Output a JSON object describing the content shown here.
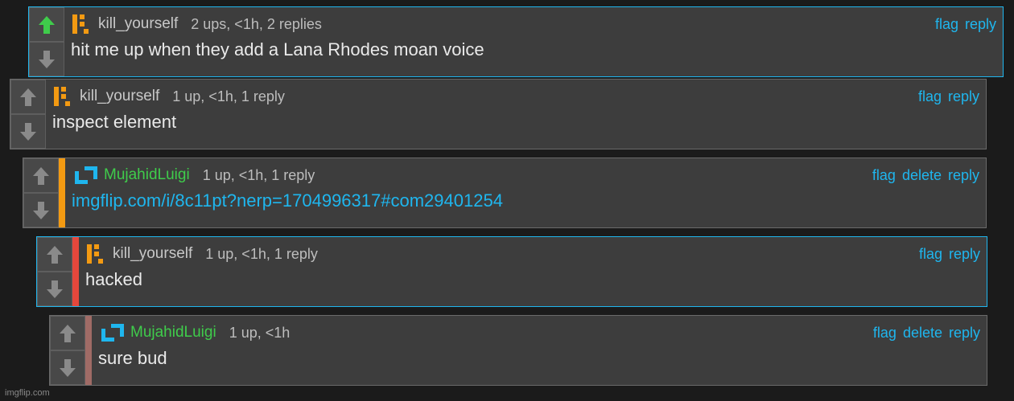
{
  "comments": [
    {
      "user": "kill_yourself",
      "meta": "2 ups, <1h, 2 replies",
      "flag": "flag",
      "delete": null,
      "reply": "reply",
      "text": "hit me up when they add a Lana Rhodes moan voice",
      "upvoted": true,
      "avatar": "k-logo",
      "stripe": null,
      "highlighted": true,
      "link": false
    },
    {
      "user": "kill_yourself",
      "meta": "1 up, <1h, 1 reply",
      "flag": "flag",
      "delete": null,
      "reply": "reply",
      "text": "inspect element",
      "upvoted": false,
      "avatar": "k-logo",
      "stripe": null,
      "highlighted": false,
      "link": false
    },
    {
      "user": "MujahidLuigi",
      "meta": "1 up, <1h, 1 reply",
      "flag": "flag",
      "delete": "delete",
      "reply": "reply",
      "text": "imgflip.com/i/8c11pt?nerp=1704996317#com29401254",
      "upvoted": false,
      "avatar": "bracket-logo",
      "stripe": "#f39a12",
      "highlighted": false,
      "link": true
    },
    {
      "user": "kill_yourself",
      "meta": "1 up, <1h, 1 reply",
      "flag": "flag",
      "delete": null,
      "reply": "reply",
      "text": "hacked",
      "upvoted": false,
      "avatar": "k-logo",
      "stripe": "#e4473c",
      "highlighted": true,
      "link": false
    },
    {
      "user": "MujahidLuigi",
      "meta": "1 up, <1h",
      "flag": "flag",
      "delete": "delete",
      "reply": "reply",
      "text": "sure bud",
      "upvoted": false,
      "avatar": "bracket-logo",
      "stripe": "#a06b66",
      "highlighted": false,
      "link": false
    }
  ],
  "colors": {
    "accent": "#1fb6ee",
    "upvote_active": "#3fcc4b",
    "orange_avatar": "#f39a12",
    "green_user": "#3fcc4b"
  },
  "watermark": "imgflip.com"
}
